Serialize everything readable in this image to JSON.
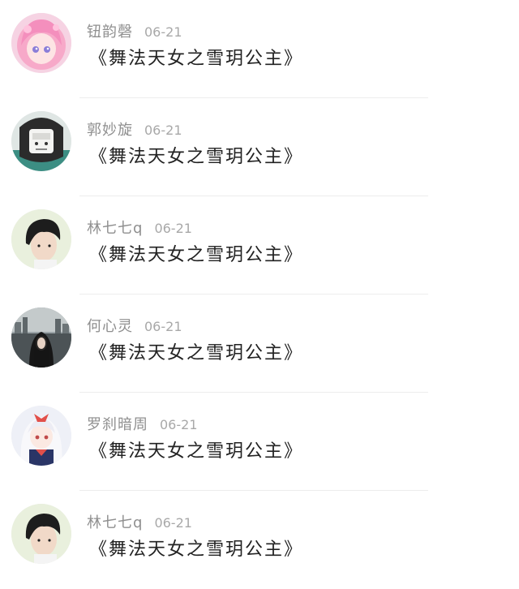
{
  "comments": [
    {
      "name": "钮韵磬",
      "date": "06-21",
      "message": "《舞法天女之雪玥公主》",
      "avatar_icon": "pink-anime-girl-avatar-icon"
    },
    {
      "name": "郭妙旋",
      "date": "06-21",
      "message": "《舞法天女之雪玥公主》",
      "avatar_icon": "masked-character-avatar-icon"
    },
    {
      "name": "林七七q",
      "date": "06-21",
      "message": "《舞法天女之雪玥公主》",
      "avatar_icon": "boy-portrait-avatar-icon"
    },
    {
      "name": "何心灵",
      "date": "06-21",
      "message": "《舞法天女之雪玥公主》",
      "avatar_icon": "girl-cityscape-avatar-icon"
    },
    {
      "name": "罗刹暗周",
      "date": "06-21",
      "message": "《舞法天女之雪玥公主》",
      "avatar_icon": "white-hair-anime-girl-avatar-icon"
    },
    {
      "name": "林七七q",
      "date": "06-21",
      "message": "《舞法天女之雪玥公主》",
      "avatar_icon": "boy-portrait-avatar-icon"
    }
  ]
}
